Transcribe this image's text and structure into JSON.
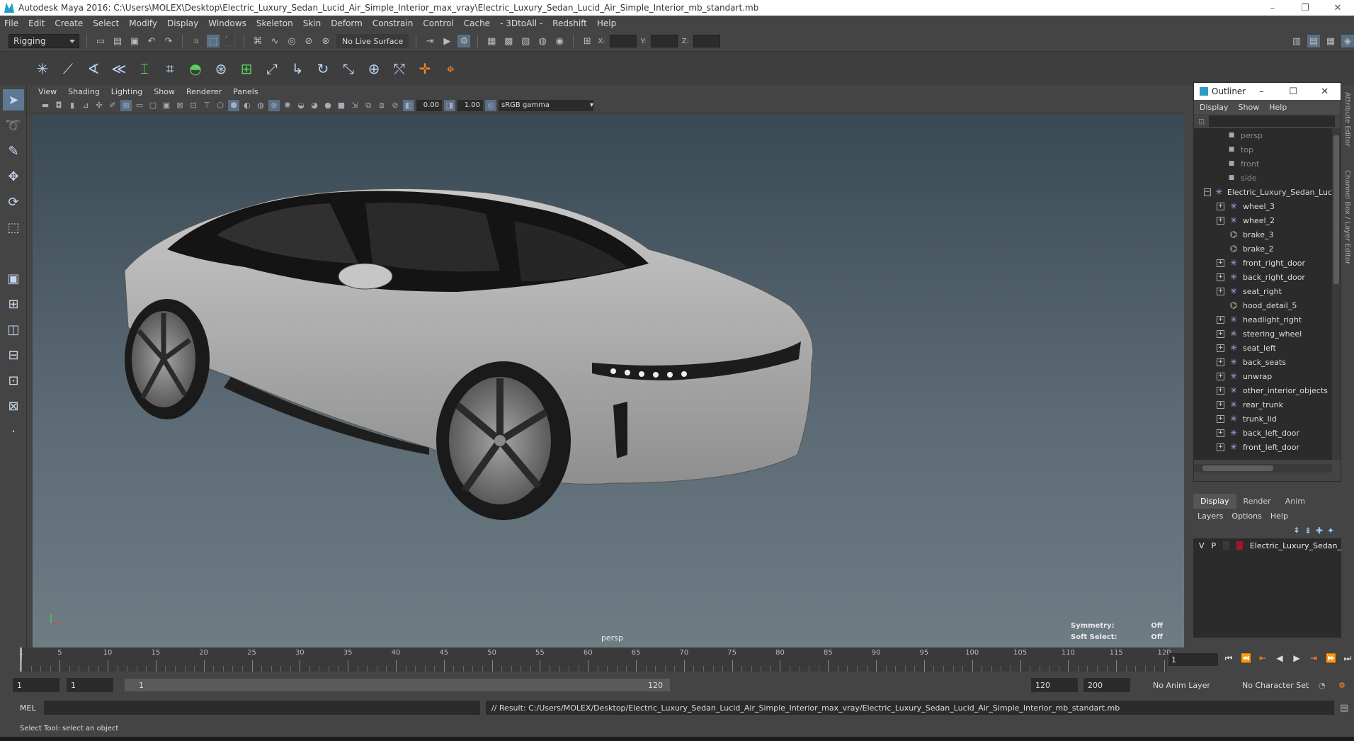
{
  "window": {
    "title": "Autodesk Maya 2016: C:\\Users\\MOLEX\\Desktop\\Electric_Luxury_Sedan_Lucid_Air_Simple_Interior_max_vray\\Electric_Luxury_Sedan_Lucid_Air_Simple_Interior_mb_standart.mb",
    "minimize": "–",
    "restore": "❐",
    "close": "✕"
  },
  "menubar": [
    "File",
    "Edit",
    "Create",
    "Select",
    "Modify",
    "Display",
    "Windows",
    "Skeleton",
    "Skin",
    "Deform",
    "Constrain",
    "Control",
    "Cache",
    "- 3DtoAll -",
    "Redshift",
    "Help"
  ],
  "statusline": {
    "mode": "Rigging",
    "live_surface": "No Live Surface",
    "x_label": "X:",
    "y_label": "Y:",
    "z_label": "Z:"
  },
  "panel": {
    "menu": [
      "View",
      "Shading",
      "Lighting",
      "Show",
      "Renderer",
      "Panels"
    ],
    "exposure": "0.00",
    "gamma": "1.00",
    "color_space": "sRGB gamma"
  },
  "viewport": {
    "camera": "persp",
    "symmetry_label": "Symmetry:",
    "symmetry_value": "Off",
    "soft_select_label": "Soft Select:",
    "soft_select_value": "Off"
  },
  "outliner": {
    "title": "Outliner",
    "menu": [
      "Display",
      "Show",
      "Help"
    ],
    "items": [
      {
        "label": "persp",
        "type": "camera"
      },
      {
        "label": "top",
        "type": "camera"
      },
      {
        "label": "front",
        "type": "camera"
      },
      {
        "label": "side",
        "type": "camera"
      },
      {
        "label": "Electric_Luxury_Sedan_Luc",
        "type": "root"
      },
      {
        "label": "wheel_3",
        "type": "group"
      },
      {
        "label": "wheel_2",
        "type": "group"
      },
      {
        "label": "brake_3",
        "type": "mesh"
      },
      {
        "label": "brake_2",
        "type": "mesh"
      },
      {
        "label": "front_right_door",
        "type": "group"
      },
      {
        "label": "back_right_door",
        "type": "group"
      },
      {
        "label": "seat_right",
        "type": "group"
      },
      {
        "label": "hood_detail_5",
        "type": "mesh"
      },
      {
        "label": "headlight_right",
        "type": "group"
      },
      {
        "label": "steering_wheel",
        "type": "group"
      },
      {
        "label": "seat_left",
        "type": "group"
      },
      {
        "label": "back_seats",
        "type": "group"
      },
      {
        "label": "unwrap",
        "type": "group"
      },
      {
        "label": "other_interior_objects",
        "type": "group"
      },
      {
        "label": "rear_trunk",
        "type": "group"
      },
      {
        "label": "trunk_lid",
        "type": "group"
      },
      {
        "label": "back_left_door",
        "type": "group"
      },
      {
        "label": "front_left_door",
        "type": "group"
      }
    ]
  },
  "layers": {
    "tabs": [
      "Display",
      "Render",
      "Anim"
    ],
    "menu": [
      "Layers",
      "Options",
      "Help"
    ],
    "row": {
      "v": "V",
      "p": "P",
      "name": "Electric_Luxury_Sedan_",
      "color": "#a0152e"
    }
  },
  "side_tabs": [
    "Attribute Editor",
    "Channel Box / Layer Editor"
  ],
  "timeline": {
    "ticks": [
      1,
      5,
      10,
      15,
      20,
      25,
      30,
      35,
      40,
      45,
      50,
      55,
      60,
      65,
      70,
      75,
      80,
      85,
      90,
      95,
      100,
      105,
      110,
      115,
      120
    ],
    "current_frame": "1"
  },
  "range": {
    "start": "1",
    "inner_start": "1",
    "bar_start": "1",
    "bar_end": "120",
    "anim_end": "120",
    "playback_end": "200",
    "anim_layer": "No Anim Layer",
    "character_set": "No Character Set"
  },
  "command": {
    "label": "MEL",
    "result": "// Result: C:/Users/MOLEX/Desktop/Electric_Luxury_Sedan_Lucid_Air_Simple_Interior_max_vray/Electric_Luxury_Sedan_Lucid_Air_Simple_Interior_mb_standart.mb"
  },
  "help_line": "Select Tool: select an object"
}
